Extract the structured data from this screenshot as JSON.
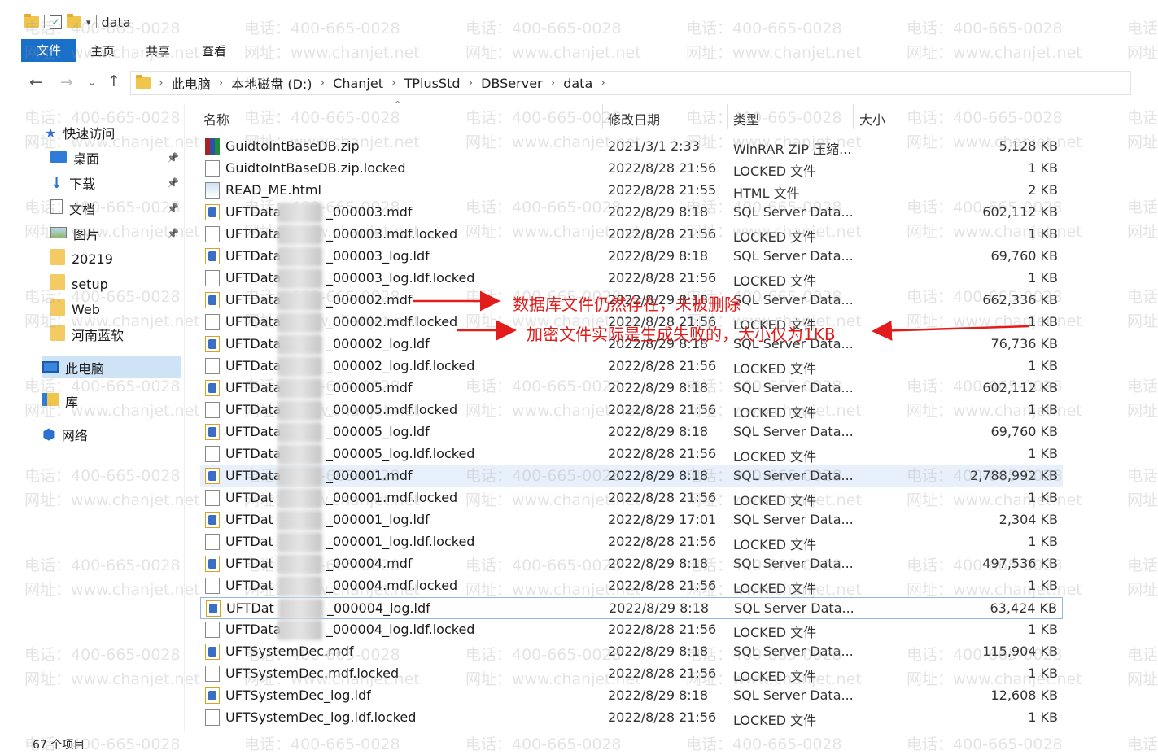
{
  "window": {
    "title": "data",
    "ribbon_tabs": [
      "文件",
      "主页",
      "共享",
      "查看"
    ]
  },
  "address": {
    "crumbs": [
      "此电脑",
      "本地磁盘 (D:)",
      "Chanjet",
      "TPlusStd",
      "DBServer",
      "data"
    ]
  },
  "sidebar": {
    "items": [
      {
        "label": "快速访问",
        "icon": "star-icon"
      },
      {
        "label": "桌面",
        "icon": "desktop-icon",
        "pinned": true
      },
      {
        "label": "下载",
        "icon": "download-icon",
        "pinned": true
      },
      {
        "label": "文档",
        "icon": "document-icon",
        "pinned": true
      },
      {
        "label": "图片",
        "icon": "picture-icon",
        "pinned": true
      },
      {
        "label": "20219",
        "icon": "folder-icon"
      },
      {
        "label": "setup",
        "icon": "folder-icon"
      },
      {
        "label": "Web",
        "icon": "folder-icon"
      },
      {
        "label": "河南蓝软",
        "icon": "folder-icon"
      },
      {
        "label": "此电脑",
        "icon": "computer-icon",
        "selected": true
      },
      {
        "label": "库",
        "icon": "library-icon"
      },
      {
        "label": "网络",
        "icon": "network-icon"
      }
    ]
  },
  "columns": {
    "name": "名称",
    "date": "修改日期",
    "type": "类型",
    "size": "大小"
  },
  "files": [
    {
      "name": "GuidtoIntBaseDB.zip",
      "date": "2021/3/1 2:33",
      "type": "WinRAR ZIP 压缩...",
      "size": "5,128 KB",
      "icon": "zip"
    },
    {
      "name": "GuidtoIntBaseDB.zip.locked",
      "date": "2022/8/28 21:56",
      "type": "LOCKED 文件",
      "size": "1 KB",
      "icon": "doc"
    },
    {
      "name": "READ_ME.html",
      "date": "2022/8/28 21:55",
      "type": "HTML 文件",
      "size": "2 KB",
      "icon": "html"
    },
    {
      "name": "UFTData",
      "name_end": "_000003.mdf",
      "date": "2022/8/29 8:18",
      "type": "SQL Server Data...",
      "size": "602,112 KB",
      "icon": "sql"
    },
    {
      "name": "UFTData.",
      "name_end": "_000003.mdf.locked",
      "date": "2022/8/28 21:56",
      "type": "LOCKED 文件",
      "size": "1 KB",
      "icon": "doc"
    },
    {
      "name": "UFTData0",
      "name_end": "_000003_log.ldf",
      "date": "2022/8/29 8:18",
      "type": "SQL Server Data...",
      "size": "69,760 KB",
      "icon": "sql"
    },
    {
      "name": "UFTData",
      "name_end": "_000003_log.ldf.locked",
      "date": "2022/8/28 21:56",
      "type": "LOCKED 文件",
      "size": "1 KB",
      "icon": "doc"
    },
    {
      "name": "UFTData",
      "name_end": "_000002.mdf",
      "date": "2022/8/29 8:18",
      "type": "SQL Server Data...",
      "size": "662,336 KB",
      "icon": "sql"
    },
    {
      "name": "UFTData",
      "name_end": "_000002.mdf.locked",
      "date": "2022/8/28 21:56",
      "type": "LOCKED 文件",
      "size": "1 KB",
      "icon": "doc"
    },
    {
      "name": "UFTData",
      "name_end": "_000002_log.ldf",
      "date": "2022/8/29 8:18",
      "type": "SQL Server Data...",
      "size": "76,736 KB",
      "icon": "sql"
    },
    {
      "name": "UFTData",
      "name_end": "_000002_log.ldf.locked",
      "date": "2022/8/28 21:56",
      "type": "LOCKED 文件",
      "size": "1 KB",
      "icon": "doc"
    },
    {
      "name": "UFTData",
      "name_end": "_000005.mdf",
      "date": "2022/8/29 8:18",
      "type": "SQL Server Data...",
      "size": "602,112 KB",
      "icon": "sql"
    },
    {
      "name": "UFTData",
      "name_end": "_000005.mdf.locked",
      "date": "2022/8/28 21:56",
      "type": "LOCKED 文件",
      "size": "1 KB",
      "icon": "doc"
    },
    {
      "name": "UFTData",
      "name_end": "_000005_log.ldf",
      "date": "2022/8/29 8:18",
      "type": "SQL Server Data...",
      "size": "69,760 KB",
      "icon": "sql"
    },
    {
      "name": "UFTData",
      "name_end": "_000005_log.ldf.locked",
      "date": "2022/8/28 21:56",
      "type": "LOCKED 文件",
      "size": "1 KB",
      "icon": "doc"
    },
    {
      "name": "UFTData",
      "name_end": "_000001.mdf",
      "date": "2022/8/29 8:18",
      "type": "SQL Server Data...",
      "size": "2,788,992 KB",
      "icon": "sql",
      "highlight": true
    },
    {
      "name": "UFTDat",
      "name_end": "_000001.mdf.locked",
      "date": "2022/8/28 21:56",
      "type": "LOCKED 文件",
      "size": "1 KB",
      "icon": "doc"
    },
    {
      "name": "UFTDat",
      "name_end": "_000001_log.ldf",
      "date": "2022/8/29 17:01",
      "type": "SQL Server Data...",
      "size": "2,304 KB",
      "icon": "sql"
    },
    {
      "name": "UFTDat",
      "name_end": "_000001_log.ldf.locked",
      "date": "2022/8/28 21:56",
      "type": "LOCKED 文件",
      "size": "1 KB",
      "icon": "doc"
    },
    {
      "name": "UFTDat",
      "name_end": "_000004.mdf",
      "date": "2022/8/29 8:18",
      "type": "SQL Server Data...",
      "size": "497,536 KB",
      "icon": "sql"
    },
    {
      "name": "UFTDat",
      "name_end": "_000004.mdf.locked",
      "date": "2022/8/28 21:56",
      "type": "LOCKED 文件",
      "size": "1 KB",
      "icon": "doc"
    },
    {
      "name": "UFTDat",
      "name_end": "_000004_log.ldf",
      "date": "2022/8/29 8:18",
      "type": "SQL Server Data...",
      "size": "63,424 KB",
      "icon": "sql",
      "focused": true
    },
    {
      "name": "UFTData",
      "name_end": "_000004_log.ldf.locked",
      "date": "2022/8/28 21:56",
      "type": "LOCKED 文件",
      "size": "1 KB",
      "icon": "doc"
    },
    {
      "name": "UFTSystemDec.mdf",
      "date": "2022/8/29 8:18",
      "type": "SQL Server Data...",
      "size": "115,904 KB",
      "icon": "sql"
    },
    {
      "name": "UFTSystemDec.mdf.locked",
      "date": "2022/8/28 21:56",
      "type": "LOCKED 文件",
      "size": "1 KB",
      "icon": "doc"
    },
    {
      "name": "UFTSystemDec_log.ldf",
      "date": "2022/8/29 8:18",
      "type": "SQL Server Data...",
      "size": "12,608 KB",
      "icon": "sql"
    },
    {
      "name": "UFTSystemDec_log.ldf.locked",
      "date": "2022/8/28 21:56",
      "type": "LOCKED 文件",
      "size": "1 KB",
      "icon": "doc"
    }
  ],
  "annotations": {
    "note1": "数据库文件仍然存在，未被删除",
    "note2": "加密文件实际是生成失败的，大小仅为1KB",
    "color": "#e21b1b"
  },
  "status": {
    "item_count": "67 个项目"
  },
  "watermark": {
    "phone": "电话：400-665-0028",
    "site": "网址：www.chanjet.net"
  }
}
